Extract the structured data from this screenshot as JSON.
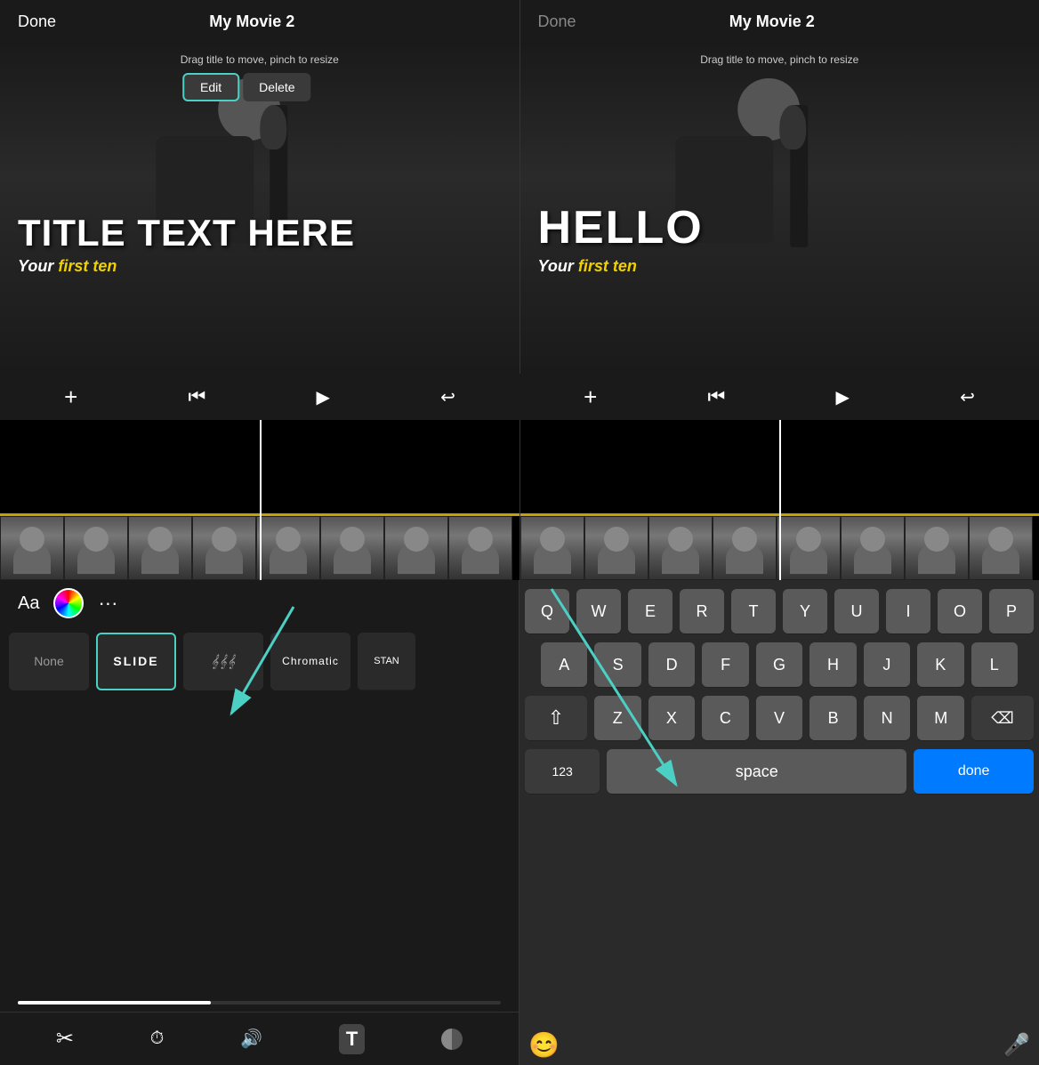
{
  "left_panel": {
    "done_label": "Done",
    "title": "My Movie 2",
    "drag_hint": "Drag title to move, pinch to resize",
    "edit_button": "Edit",
    "delete_button": "Delete",
    "title_main": "TITLE TEXT HERE",
    "title_sub_plain": "Your ",
    "title_sub_highlight": "first ten"
  },
  "right_panel": {
    "done_label": "Done",
    "title": "My Movie 2",
    "drag_hint": "Drag title to move, pinch to resize",
    "title_main": "HELLO",
    "title_sub_plain": "Your ",
    "title_sub_highlight": "first ten"
  },
  "controls": {
    "plus": "+",
    "rewind": "⏮",
    "play": "▶",
    "undo": "↩"
  },
  "font_controls": {
    "aa_label": "Aa",
    "more_label": "···"
  },
  "presets": [
    {
      "id": "none",
      "label": "None"
    },
    {
      "id": "slide",
      "label": "SLIDE"
    },
    {
      "id": "wave",
      "label": "𝄞"
    },
    {
      "id": "chromatic",
      "label": "Chromatic"
    },
    {
      "id": "stan",
      "label": "STAN"
    }
  ],
  "toolbar": {
    "scissors": "✂",
    "speed": "⏱",
    "volume": "🔊",
    "title": "T",
    "filter": "◐"
  },
  "keyboard": {
    "rows": [
      [
        "Q",
        "W",
        "E",
        "R",
        "T",
        "Y",
        "U",
        "I",
        "O",
        "P"
      ],
      [
        "A",
        "S",
        "D",
        "F",
        "G",
        "H",
        "J",
        "K",
        "L"
      ],
      [
        "Z",
        "X",
        "C",
        "V",
        "B",
        "N",
        "M"
      ]
    ],
    "shift_label": "⇧",
    "backspace_label": "⌫",
    "numbers_label": "123",
    "space_label": "space",
    "done_label": "done"
  },
  "colors": {
    "teal": "#4dd0c4",
    "blue": "#007aff",
    "yellow": "#f0d000"
  }
}
